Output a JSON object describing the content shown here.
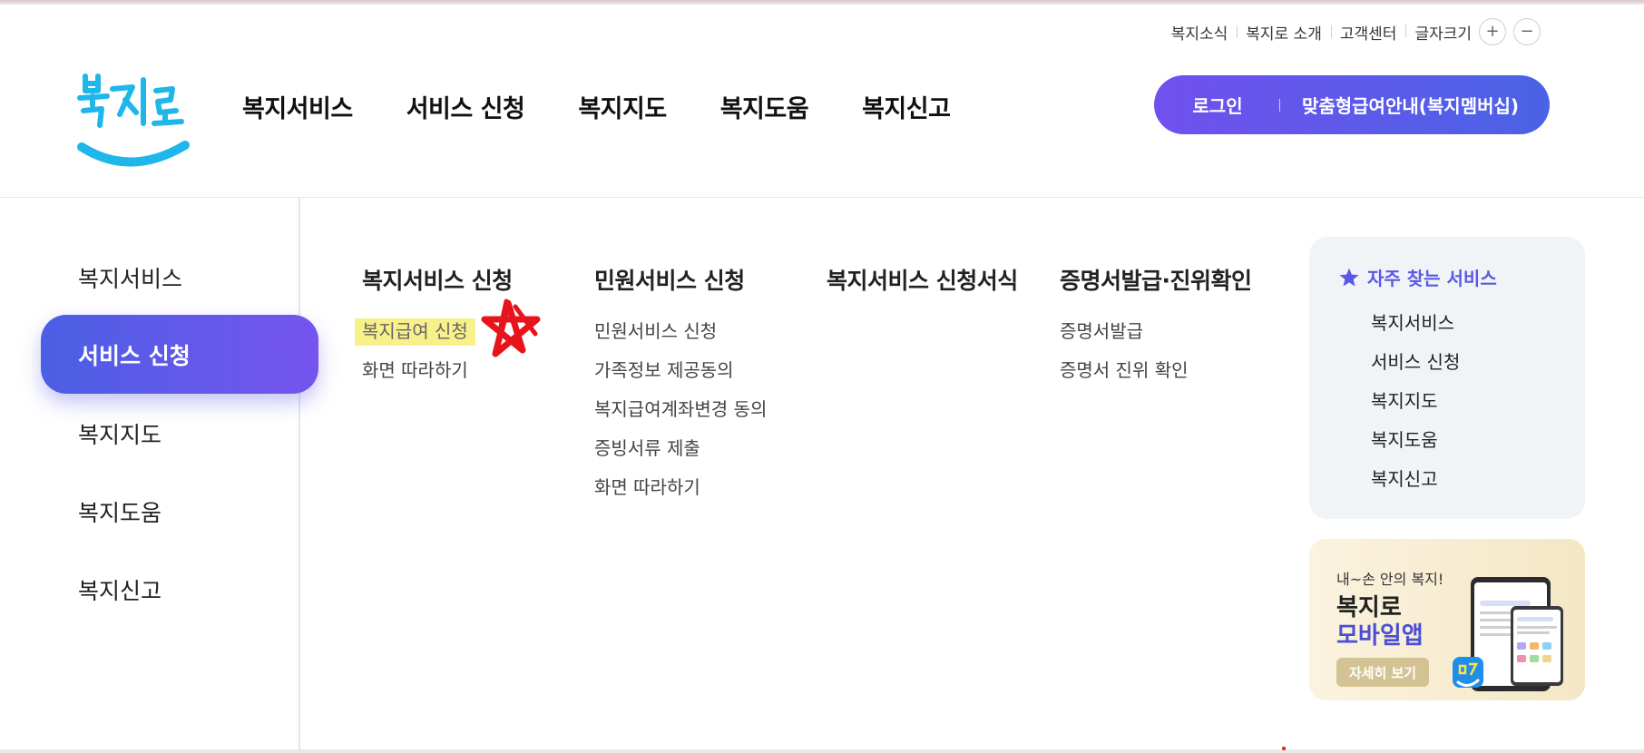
{
  "util_bar": {
    "items": [
      "복지소식",
      "복지로 소개",
      "고객센터"
    ],
    "font_size_label": "글자크기",
    "plus": "+",
    "minus": "−"
  },
  "logo": {
    "text": "복지로"
  },
  "gnb": [
    "복지서비스",
    "서비스 신청",
    "복지지도",
    "복지도움",
    "복지신고"
  ],
  "member_pill": {
    "login": "로그인",
    "membership": "맞춤형급여안내(복지멤버십)"
  },
  "left_nav": {
    "items": [
      "복지서비스",
      "서비스 신청",
      "복지지도",
      "복지도움",
      "복지신고"
    ],
    "active_index": 1
  },
  "columns": [
    {
      "heading": "복지서비스 신청",
      "links": [
        "복지급여 신청",
        "화면 따라하기"
      ]
    },
    {
      "heading": "민원서비스 신청",
      "links": [
        "민원서비스 신청",
        "가족정보 제공동의",
        "복지급여계좌변경 동의",
        "증빙서류 제출",
        "화면 따라하기"
      ]
    },
    {
      "heading": "복지서비스 신청서식",
      "links": []
    },
    {
      "heading": "증명서발급·진위확인",
      "links": [
        "증명서발급",
        "증명서 진위 확인"
      ]
    }
  ],
  "favorites": {
    "title": "자주 찾는 서비스",
    "items": [
      "복지서비스",
      "서비스 신청",
      "복지지도",
      "복지도움",
      "복지신고"
    ]
  },
  "banner": {
    "small": "내~손 안의 복지!",
    "line1": "복지로",
    "line2": "모바일앱",
    "button": "자세히 보기"
  },
  "colors": {
    "accent_start": "#4b5fe4",
    "accent_end": "#7654ef",
    "highlight": "#f7f08b",
    "annotation_star": "#e8141b",
    "logo_blue": "#1fb7ea"
  }
}
